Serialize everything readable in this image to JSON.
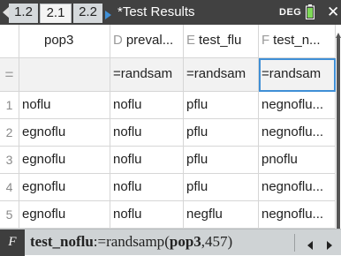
{
  "tabs": [
    {
      "label": "1.2"
    },
    {
      "label": "2.1"
    },
    {
      "label": "2.2"
    }
  ],
  "document_title": "*Test Results",
  "angle_mode": "DEG",
  "columns": [
    {
      "letter": "",
      "name": "pop3"
    },
    {
      "letter": "D",
      "name": "preval..."
    },
    {
      "letter": "E",
      "name": "test_flu"
    },
    {
      "letter": "F",
      "name": "test_n..."
    }
  ],
  "formula_row": {
    "marker": "=",
    "cells": [
      "",
      "=randsam",
      "=randsam",
      "=randsam"
    ]
  },
  "rows": [
    {
      "num": "1",
      "cells": [
        "noflu",
        "noflu",
        "pflu",
        "negnoflu..."
      ]
    },
    {
      "num": "2",
      "cells": [
        "egnoflu",
        "noflu",
        "pflu",
        "negnoflu..."
      ]
    },
    {
      "num": "3",
      "cells": [
        "egnoflu",
        "noflu",
        "pflu",
        "pnoflu"
      ]
    },
    {
      "num": "4",
      "cells": [
        "egnoflu",
        "noflu",
        "pflu",
        "negnoflu..."
      ]
    },
    {
      "num": "5",
      "cells": [
        "egnoflu",
        "noflu",
        "negflu",
        "negnoflu..."
      ]
    }
  ],
  "entry_line": {
    "label": "F",
    "var_name": "test_noflu",
    "assign": ":=randsamp",
    "open": "(",
    "arg1": "pop3",
    "rest": ",457)"
  },
  "colors": {
    "title_bar": "#414141",
    "selection": "#3f8fd6",
    "entry_bg": "#cfd3d5"
  }
}
